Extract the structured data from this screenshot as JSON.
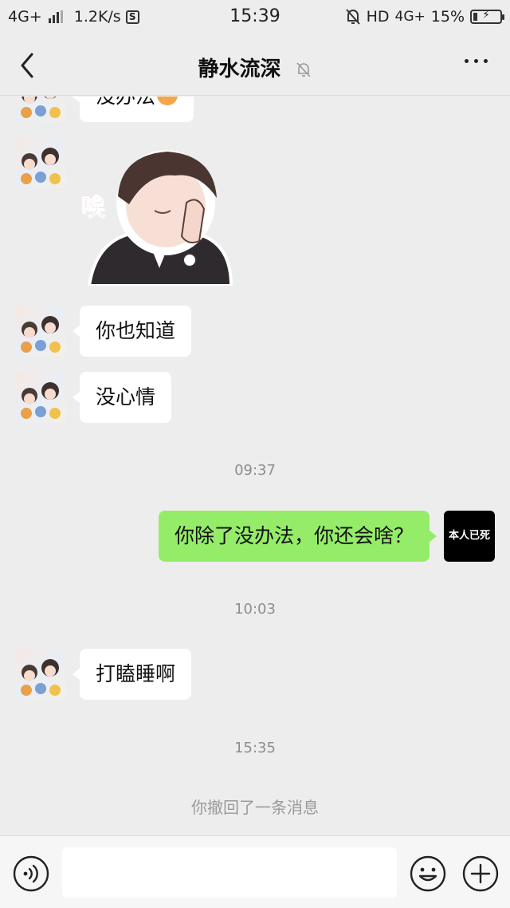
{
  "status_bar": {
    "network": "4G+",
    "speed": "1.2K/s",
    "s_badge": "S",
    "time": "15:39",
    "hd": "HD",
    "network2": "4G+",
    "battery": "15%",
    "battery_level": 0.15
  },
  "header": {
    "title": "静水流深",
    "back_icon": "chevron-left-icon",
    "mute_icon": "bell-muted-icon",
    "more_icon": "more-horizontal-icon"
  },
  "messages": [
    {
      "type": "incoming-text",
      "text": "没办法",
      "emoji": "frowning-face-emoji",
      "partially_visible": true
    },
    {
      "type": "incoming-sticker",
      "sticker_text": "唉"
    },
    {
      "type": "incoming-text",
      "text": "你也知道"
    },
    {
      "type": "incoming-text",
      "text": "没心情"
    },
    {
      "type": "time",
      "text": "09:37"
    },
    {
      "type": "outgoing-text",
      "text": "你除了没办法，你还会啥？",
      "avatar_text": "本人已死"
    },
    {
      "type": "time",
      "text": "10:03"
    },
    {
      "type": "incoming-text",
      "text": "打瞌睡啊"
    },
    {
      "type": "time",
      "text": "15:35"
    },
    {
      "type": "system",
      "text": "你撤回了一条消息"
    }
  ],
  "input_bar": {
    "value": "",
    "voice_icon": "voice-icon",
    "emoji_icon": "emoji-icon",
    "plus_icon": "plus-icon"
  },
  "colors": {
    "background": "#ededed",
    "incoming_bubble": "#ffffff",
    "outgoing_bubble": "#95ec69",
    "time_text": "#8e8e8e",
    "self_avatar": "#000000"
  }
}
